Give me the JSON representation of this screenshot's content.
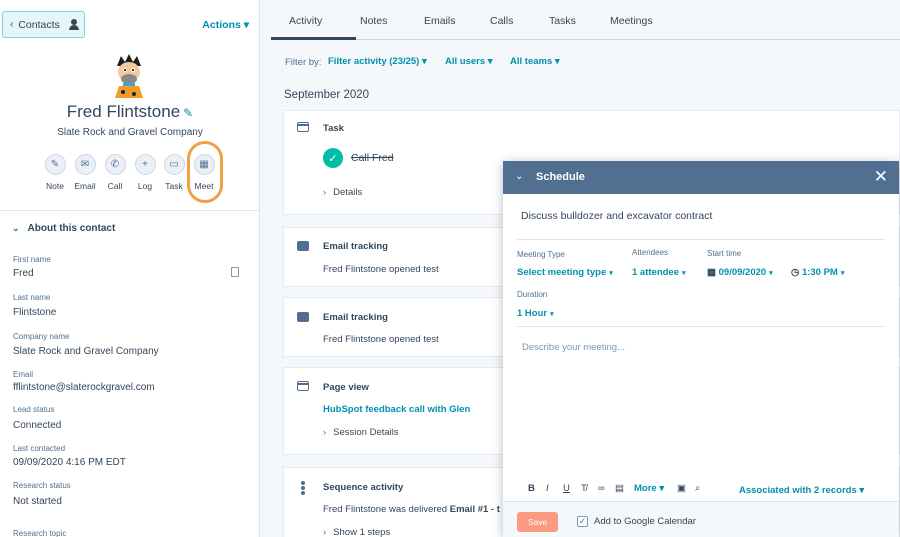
{
  "sidebar": {
    "back_label": "Contacts",
    "actions_label": "Actions",
    "name": "Fred Flintstone",
    "company": "Slate Rock and Gravel Company",
    "action_buttons": [
      {
        "label": "Note",
        "icon": "note-icon"
      },
      {
        "label": "Email",
        "icon": "email-icon"
      },
      {
        "label": "Call",
        "icon": "phone-icon"
      },
      {
        "label": "Log",
        "icon": "plus-icon"
      },
      {
        "label": "Task",
        "icon": "task-icon"
      },
      {
        "label": "Meet",
        "icon": "calendar-icon"
      }
    ],
    "about_title": "About this contact",
    "properties": [
      {
        "label": "First name",
        "value": "Fred"
      },
      {
        "label": "Last name",
        "value": "Flintstone"
      },
      {
        "label": "Company name",
        "value": "Slate Rock and Gravel Company"
      },
      {
        "label": "Email",
        "value": "fflintstone@slaterockgravel.com"
      },
      {
        "label": "Lead status",
        "value": "Connected"
      },
      {
        "label": "Last contacted",
        "value": "09/09/2020 4:16 PM EDT"
      },
      {
        "label": "Research status",
        "value": "Not started"
      },
      {
        "label": "Research topic",
        "value": ""
      }
    ]
  },
  "tabs": [
    "Activity",
    "Notes",
    "Emails",
    "Calls",
    "Tasks",
    "Meetings"
  ],
  "filters": {
    "label": "Filter by:",
    "activity": "Filter activity (23/25)",
    "users": "All users",
    "teams": "All teams"
  },
  "month": "September 2020",
  "timeline": {
    "task": {
      "type": "Task",
      "title": "Call Fred",
      "details": "Details"
    },
    "email1": {
      "type": "Email tracking",
      "text": "Fred Flintstone opened test"
    },
    "email2": {
      "type": "Email tracking",
      "text": "Fred Flintstone opened test"
    },
    "pageview": {
      "type": "Page view",
      "link": "HubSpot feedback call with Glen",
      "details": "Session Details"
    },
    "sequence": {
      "type": "Sequence activity",
      "text_prefix": "Fred Flintstone was delivered ",
      "text_bold": "Email #1 - t",
      "steps": "Show 1 steps"
    }
  },
  "schedule": {
    "title": "Schedule",
    "subject": "Discuss bulldozer and excavator contract",
    "meeting_type_label": "Meeting Type",
    "meeting_type_value": "Select meeting type",
    "attendees_label": "Attendees",
    "attendees_value": "1 attendee",
    "start_label": "Start time",
    "start_date": "09/09/2020",
    "start_time": "1:30 PM",
    "duration_label": "Duration",
    "duration_value": "1 Hour",
    "description_placeholder": "Describe your meeting...",
    "toolbar": {
      "bold": "B",
      "italic": "I",
      "underline": "U",
      "more": "More"
    },
    "associated": "Associated with 2 records",
    "save": "Save",
    "google_calendar": "Add to Google Calendar",
    "google_calendar_checked": true
  },
  "colors": {
    "accent": "#0091ae",
    "header": "#516f90",
    "highlight_ring": "#f0a045",
    "save_button": "#ff7a59",
    "complete": "#00bda5"
  }
}
